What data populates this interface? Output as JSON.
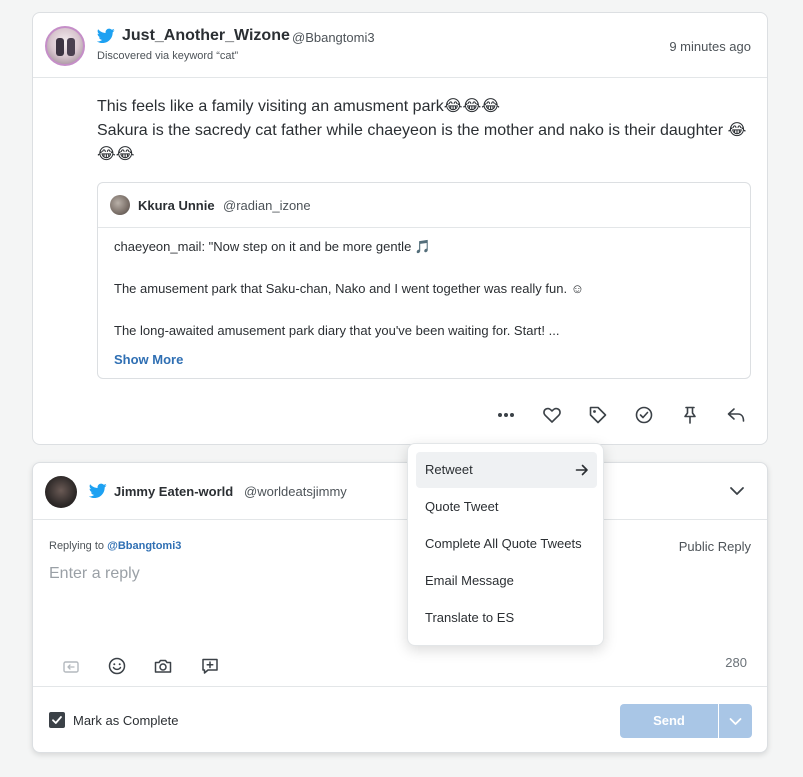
{
  "tweet": {
    "author_name": "Just_Another_Wizone",
    "author_handle": "@Bbangtomi3",
    "discovered": "Discovered via keyword “cat”",
    "time_ago": "9 minutes ago",
    "text_line1": "This feels like a family visiting an amusment park😂😂😂",
    "text_line2": "Sakura is the sacredy cat father while chaeyeon is the mother and nako is their daughter 😂😂😂",
    "quote": {
      "author_name": "Kkura Unnie",
      "author_handle": "@radian_izone",
      "line1": "chaeyeon_mail: \"Now step on it and be more gentle 🎵",
      "line2": "The amusement park that Saku-chan, Nako and I went together was really fun. ☺",
      "line3": "The long-awaited amusement park diary that you've been waiting for. Start! ...",
      "show_more": "Show More"
    },
    "actions": [
      "more-icon",
      "heart-icon",
      "tag-icon",
      "check-circle-icon",
      "pin-icon",
      "reply-icon"
    ]
  },
  "menu": {
    "items": [
      "Retweet",
      "Quote Tweet",
      "Complete All Quote Tweets",
      "Email Message",
      "Translate to ES"
    ]
  },
  "reply": {
    "account_name": "Jimmy Eaten-world",
    "account_handle": "@worldeatsjimmy",
    "replying_to_label": "Replying to",
    "replying_to_handle": "@Bbangtomi3",
    "public_reply": "Public Reply",
    "placeholder": "Enter a reply",
    "char_count": "280",
    "mark_complete_label": "Mark as Complete",
    "mark_complete_checked": true,
    "send_label": "Send",
    "tools": [
      "retweet-quote-icon",
      "emoji-icon",
      "camera-icon",
      "add-comment-icon"
    ]
  },
  "colors": {
    "twitter_blue": "#1da1f2",
    "link_blue": "#2f6fb3",
    "send_button": "#a9c6e6"
  }
}
